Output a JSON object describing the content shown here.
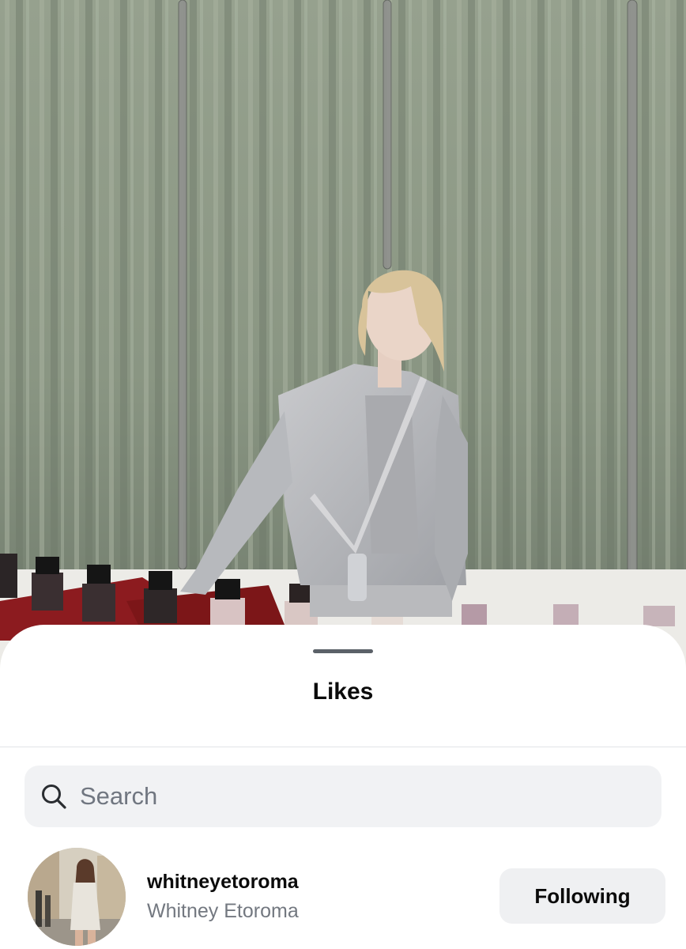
{
  "sheet": {
    "title": "Likes"
  },
  "search": {
    "placeholder": "Search",
    "value": "",
    "icon": "search-icon"
  },
  "likes": [
    {
      "username": "whitneyetoroma",
      "full_name": "Whitney Etoroma",
      "button_label": "Following"
    }
  ],
  "colors": {
    "sheet_background": "#ffffff",
    "search_background": "#f1f2f4",
    "button_background": "#eff0f2",
    "secondary_text": "#737880",
    "curtain": "#8f9a88"
  }
}
